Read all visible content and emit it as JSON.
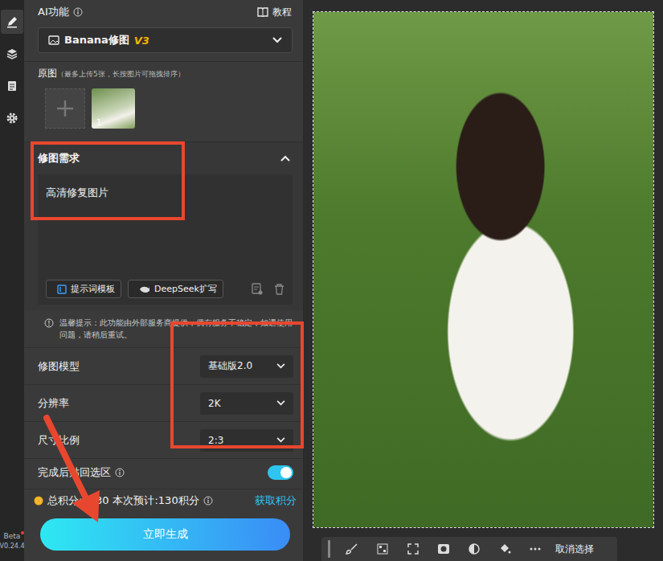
{
  "rail": {
    "items": [
      {
        "selected": true
      },
      {
        "selected": false
      },
      {
        "selected": false
      },
      {
        "selected": false
      }
    ],
    "badge": "Beta",
    "version": "V0.24.4"
  },
  "header": {
    "title": "AI功能",
    "tutorial": "教程"
  },
  "feature_select": {
    "name": "Banana修图",
    "version": "V3"
  },
  "source": {
    "label": "原图",
    "hint": "（最多上传5张，长按图片可拖拽排序）",
    "images": [
      {
        "index": "1"
      }
    ]
  },
  "prompt": {
    "label": "修图需求",
    "expanded": true,
    "text": "高清修复图片",
    "buttons": [
      "提示词模板",
      "DeepSeek扩写"
    ]
  },
  "notice": "温馨提示：此功能由外部服务商提供，偶有服务不稳定，如遇使用问题，请稍后重试。",
  "settings": [
    {
      "label": "修图模型",
      "value": "基础版2.0"
    },
    {
      "label": "分辨率",
      "value": "2K"
    },
    {
      "label": "尺寸比例",
      "value": "2:3"
    }
  ],
  "paste_back": {
    "label": "完成后贴回选区",
    "on": true
  },
  "footer": {
    "total": "总积分:1330",
    "estimate": "本次预计:130积分",
    "link": "获取积分"
  },
  "generate_button": "立即生成",
  "toolbar": {
    "deselect": "取消选择"
  }
}
